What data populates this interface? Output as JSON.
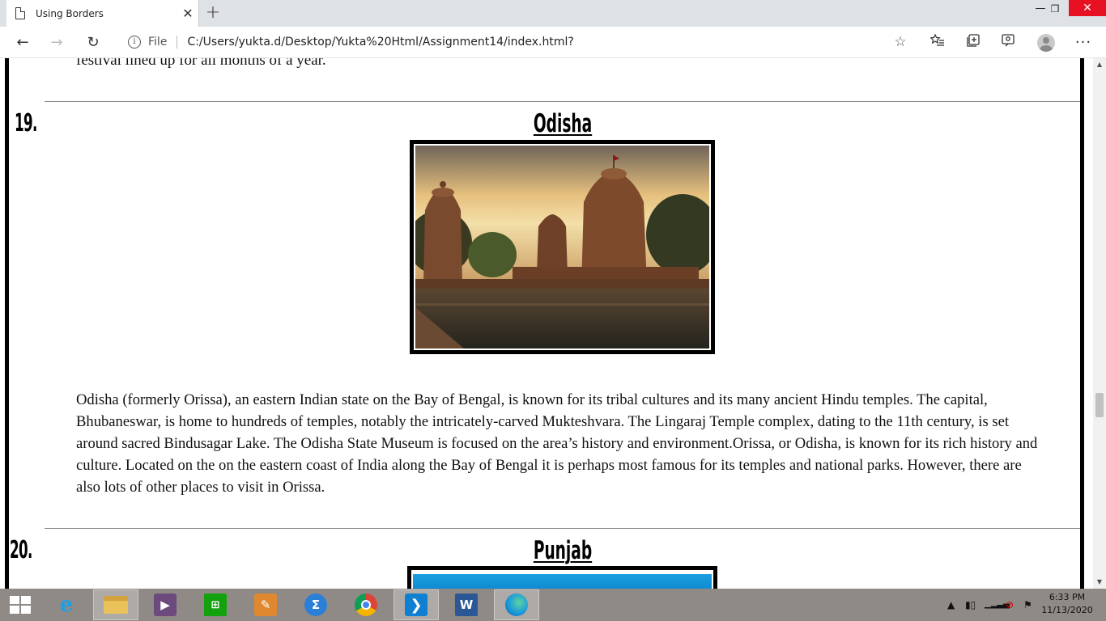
{
  "browser": {
    "tab_title": "Using Borders",
    "tab_close": "✕",
    "new_tab": "+",
    "win_min": "—",
    "win_max": "❐",
    "win_close": "✕",
    "nav_back": "←",
    "nav_forward": "→",
    "nav_reload": "↻",
    "file_label": "File",
    "url": "C:/Users/yukta.d/Desktop/Yukta%20Html/Assignment14/index.html?",
    "star": "☆",
    "more": "···"
  },
  "page": {
    "previous_tail": "festival lined up for all months of a year.",
    "sections": [
      {
        "number": "19.",
        "title": "Odisha",
        "paragraph": "Odisha (formerly Orissa), an eastern Indian state on the Bay of Bengal, is known for its tribal cultures and its many ancient Hindu temples. The capital, Bhubaneswar, is home to hundreds of temples, notably the intricately-carved Mukteshvara. The Lingaraj Temple complex, dating to the 11th century, is set around sacred Bindusagar Lake. The Odisha State Museum is focused on the area’s history and environment.Orissa, or Odisha, is known for its rich history and culture. Located on the on the eastern coast of India along the Bay of Bengal it is perhaps most famous for its temples and national parks. However, there are also lots of other places to visit in Orissa."
      },
      {
        "number": "20.",
        "title": "Punjab"
      }
    ]
  },
  "taskbar": {
    "time": "6:33 PM",
    "date": "11/13/2020",
    "apps": [
      "internet-explorer",
      "file-explorer",
      "media-player",
      "store",
      "paint-app",
      "math-input",
      "chrome",
      "vscode",
      "word",
      "edge"
    ]
  },
  "colors": {
    "close_button": "#e81123",
    "taskbar": "#8f8a86",
    "frame_border": "#000000"
  }
}
